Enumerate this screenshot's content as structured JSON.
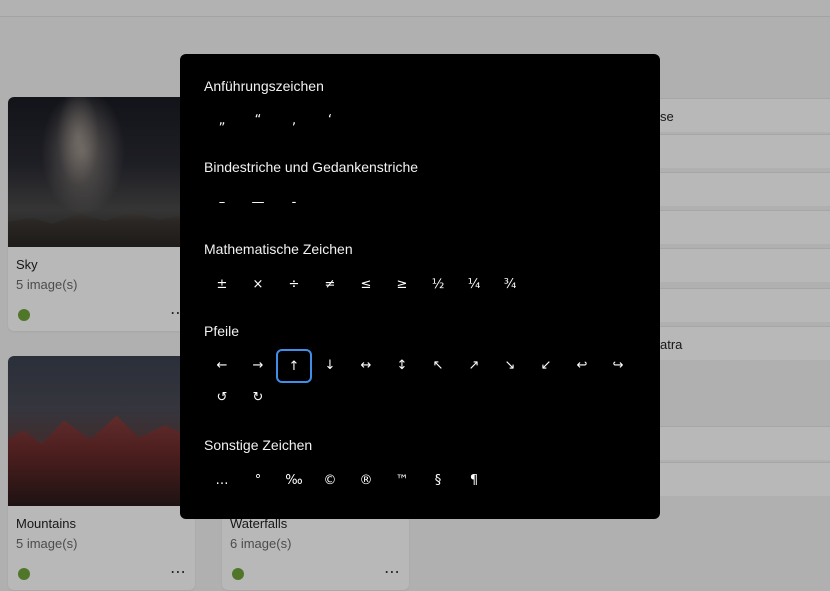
{
  "background": {
    "cards": [
      {
        "title": "Sky",
        "count": "5 image(s)",
        "more": "⋯"
      },
      {
        "title": "Mountains",
        "count": "5 image(s)",
        "more": "⋯"
      },
      {
        "title": "Waterfalls",
        "count": "6 image(s)",
        "more": "⋯"
      }
    ],
    "list_rows": [
      "se",
      "atra"
    ],
    "status_color": "#6fa63a"
  },
  "dialog": {
    "sections": [
      {
        "title": "Anführungszeichen",
        "chars": [
          "„",
          "“",
          "‚",
          "‘"
        ]
      },
      {
        "title": "Bindestriche und Gedankenstriche",
        "chars": [
          "–",
          "—",
          "-"
        ]
      },
      {
        "title": "Mathematische Zeichen",
        "chars": [
          "±",
          "×",
          "÷",
          "≠",
          "≤",
          "≥",
          "½",
          "¼",
          "¾"
        ]
      },
      {
        "title": "Pfeile",
        "chars": [
          "←",
          "→",
          "↑",
          "↓",
          "↔",
          "↕",
          "↖",
          "↗",
          "↘",
          "↙",
          "↩",
          "↪",
          "↺",
          "↻"
        ],
        "selected_index": 2
      },
      {
        "title": "Sonstige Zeichen",
        "chars": [
          "…",
          "°",
          "‰",
          "©",
          "®",
          "™",
          "§",
          "¶"
        ]
      }
    ],
    "accent_color": "#3f8ee8"
  }
}
